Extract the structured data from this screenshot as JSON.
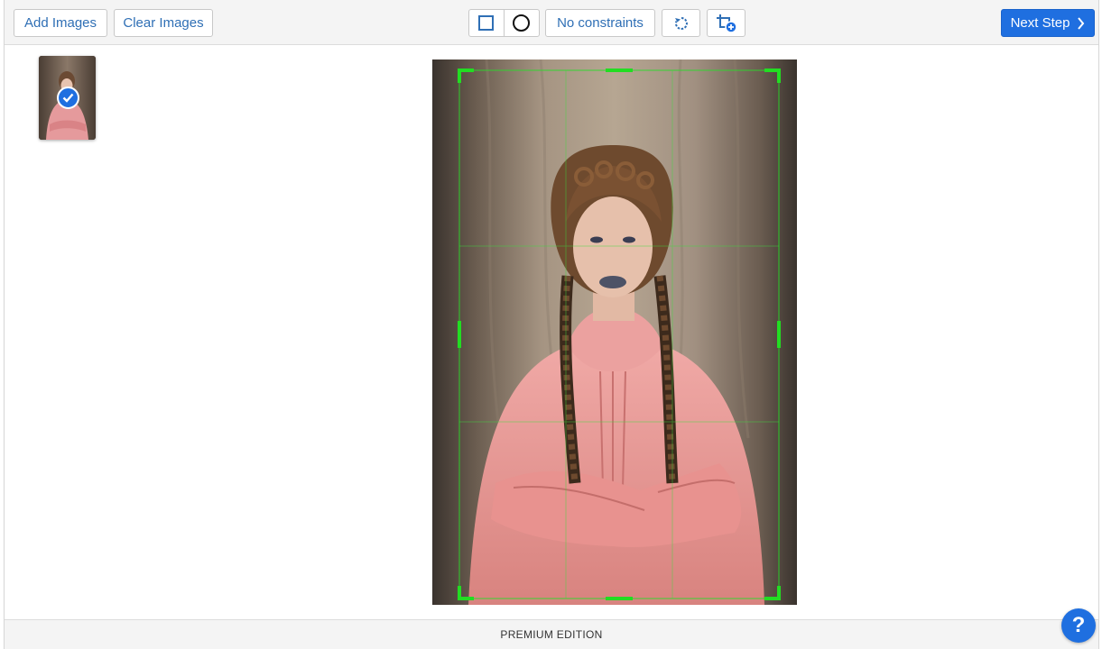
{
  "toolbar": {
    "add_images_label": "Add Images",
    "clear_images_label": "Clear Images",
    "constraints_label": "No constraints",
    "next_step_label": "Next Step",
    "icons": [
      "square-icon",
      "circle-icon",
      "rotate-icon",
      "add-crop-icon",
      "chevron-right-icon"
    ]
  },
  "thumbnails": [
    {
      "selected": true
    }
  ],
  "footer": {
    "edition_label": "PREMIUM EDITION"
  },
  "help": {
    "label": "?"
  },
  "colors": {
    "accent": "#1f6fe0",
    "crop_handle": "#22dd22",
    "button_text": "#2f6fb5"
  }
}
